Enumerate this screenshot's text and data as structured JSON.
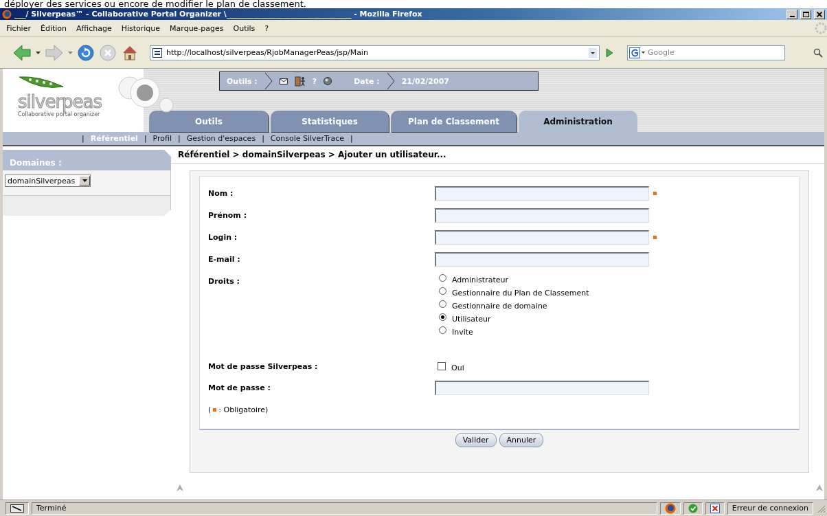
{
  "overlay_text": "déployer des services ou encore de modifier le plan de classement.",
  "window": {
    "title": "___/ Silverpeas™ - Collaborative Portal Organizer \\_________________________________ - Mozilla Firefox"
  },
  "menu": [
    "Fichier",
    "Édition",
    "Affichage",
    "Historique",
    "Marque-pages",
    "Outils",
    "?"
  ],
  "address": {
    "value": "http://localhost/silverpeas/RjobManagerPeas/jsp/Main"
  },
  "search": {
    "placeholder": "Google"
  },
  "logo": {
    "name": "silverpeas",
    "tagline": "Collaborative portal organizer"
  },
  "toolbar": {
    "label": "Outils :",
    "help": "?",
    "date_label": "Date :",
    "date": "21/02/2007"
  },
  "tabs": [
    {
      "label": "Outils",
      "selected": false
    },
    {
      "label": "Statistiques",
      "selected": false
    },
    {
      "label": "Plan de Classement",
      "selected": false
    },
    {
      "label": "Administration",
      "selected": true
    }
  ],
  "subnav": [
    {
      "label": "Référentiel",
      "selected": true
    },
    {
      "label": "Profil",
      "selected": false
    },
    {
      "label": "Gestion d'espaces",
      "selected": false
    },
    {
      "label": "Console SilverTrace",
      "selected": false
    }
  ],
  "subnav_separators": [
    "|",
    "|",
    "|",
    "|",
    "|"
  ],
  "sidebar": {
    "title": "Domaines :",
    "domain": "domainSilverpeas"
  },
  "breadcrumb": "Référentiel > domainSilverpeas > Ajouter un utilisateur...",
  "form": {
    "fields": [
      {
        "kind": "text",
        "label": "Nom :",
        "required": true
      },
      {
        "kind": "text",
        "label": "Prénom :",
        "required": false
      },
      {
        "kind": "text",
        "label": "Login :",
        "required": true
      },
      {
        "kind": "text",
        "label": "E-mail :",
        "required": false
      },
      {
        "kind": "radio",
        "label": "Droits :",
        "options": [
          {
            "label": "Administrateur",
            "selected": false
          },
          {
            "label": "Gestionnaire du Plan de Classement",
            "selected": false
          },
          {
            "label": "Gestionnaire de domaine",
            "selected": false
          },
          {
            "label": "Utilisateur",
            "selected": true
          },
          {
            "label": "Invite",
            "selected": false
          }
        ]
      },
      {
        "kind": "checkbox",
        "label": "Mot de passe Silverpeas :",
        "option": "Oui",
        "checked": false
      },
      {
        "kind": "text",
        "label": "Mot de passe :",
        "required": false
      }
    ],
    "legend_open": "(",
    "legend_text": ": Obligatoire)"
  },
  "buttons": [
    "Valider",
    "Annuler"
  ],
  "status": {
    "text": "Terminé",
    "connection": "Erreur de connexion"
  }
}
